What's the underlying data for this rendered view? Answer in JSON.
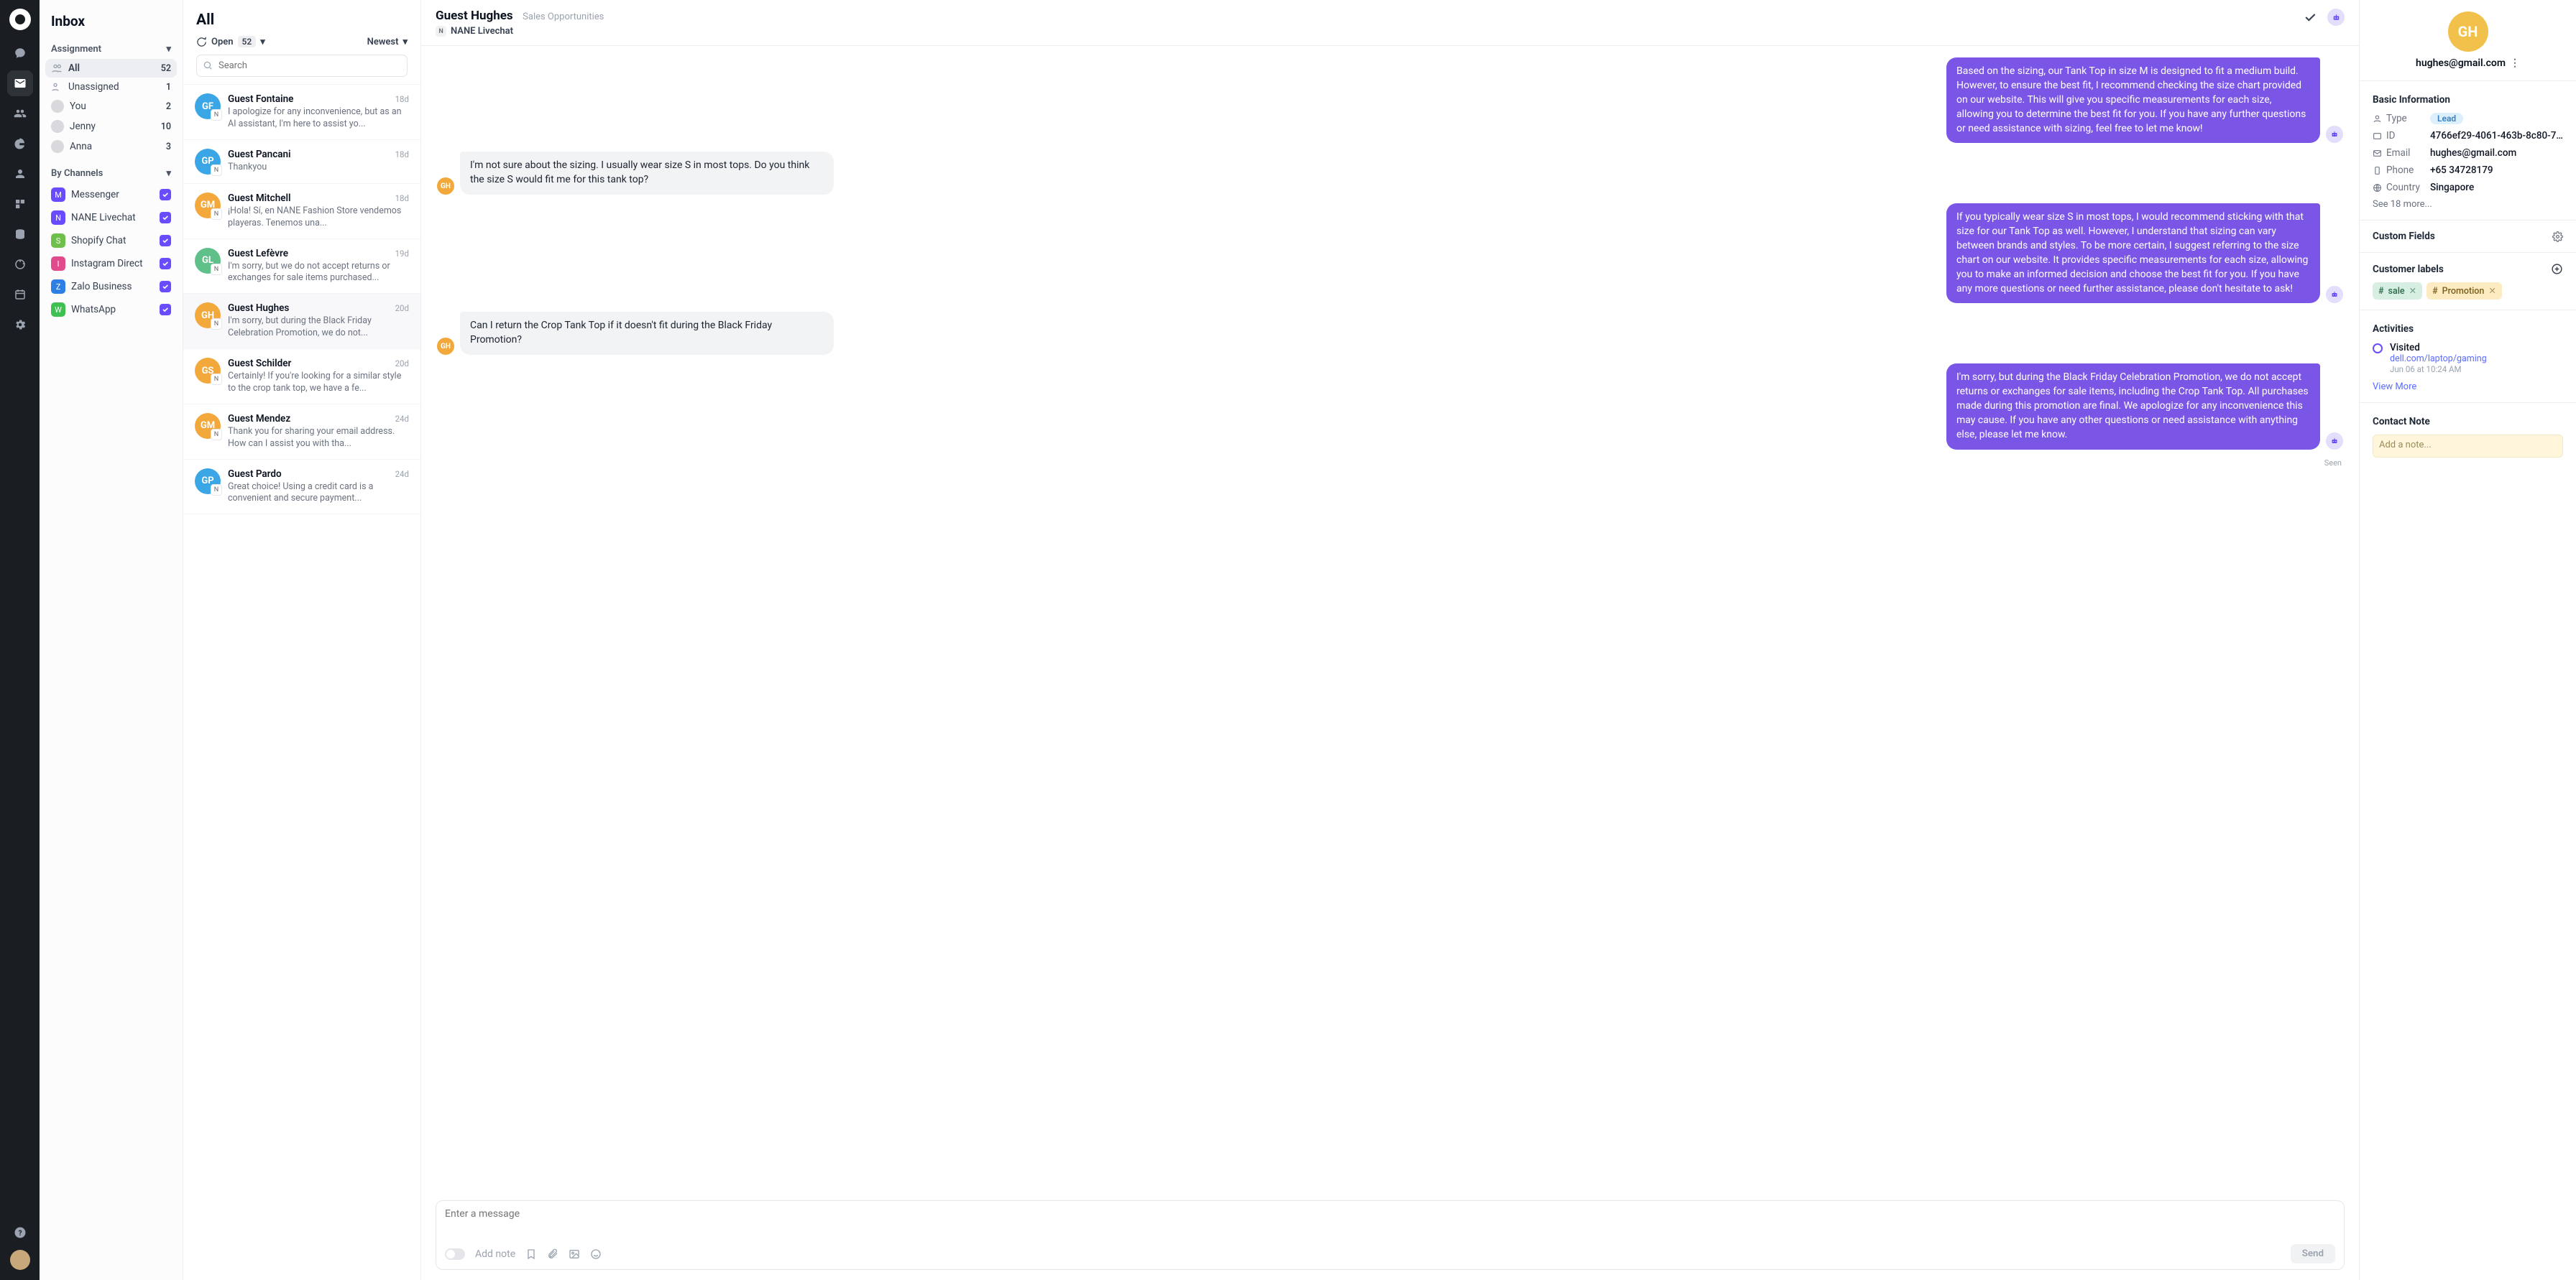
{
  "rail": {
    "items": [
      "chat",
      "inbox",
      "contacts",
      "reports",
      "profile",
      "apps",
      "data",
      "loop",
      "calendar",
      "settings"
    ]
  },
  "sidebar": {
    "title": "Inbox",
    "assignment_label": "Assignment",
    "items": [
      {
        "label": "All",
        "count": "52",
        "icon": "people"
      },
      {
        "label": "Unassigned",
        "count": "1",
        "icon": "person-outline"
      },
      {
        "label": "You",
        "count": "2",
        "icon": "avatar"
      },
      {
        "label": "Jenny",
        "count": "10",
        "icon": "avatar"
      },
      {
        "label": "Anna",
        "count": "3",
        "icon": "avatar"
      }
    ],
    "channels_label": "By Channels",
    "channels": [
      {
        "label": "Messenger",
        "color": "#6a4cff"
      },
      {
        "label": "NANE Livechat",
        "color": "#6a4cff"
      },
      {
        "label": "Shopify Chat",
        "color": "#6fbf4b"
      },
      {
        "label": "Instagram Direct",
        "color": "#e14b8c"
      },
      {
        "label": "Zalo Business",
        "color": "#2d7fe6"
      },
      {
        "label": "WhatsApp",
        "color": "#3fc051"
      }
    ]
  },
  "list": {
    "title": "All",
    "open_label": "Open",
    "open_count": "52",
    "sort_label": "Newest",
    "search_placeholder": "Search",
    "items": [
      {
        "initials": "GF",
        "color": "#3aa6e6",
        "name": "Guest Fontaine",
        "time": "18d",
        "preview": "I apologize for any inconvenience, but as an AI assistant, I'm here to assist yo..."
      },
      {
        "initials": "GP",
        "color": "#3aa6e6",
        "name": "Guest Pancani",
        "time": "18d",
        "preview": "Thankyou"
      },
      {
        "initials": "GM",
        "color": "#f2a83b",
        "name": "Guest Mitchell",
        "time": "18d",
        "preview": "¡Hola! Sí, en NANE Fashion Store vendemos playeras. Tenemos una..."
      },
      {
        "initials": "GL",
        "color": "#5fc08a",
        "name": "Guest Lefèvre",
        "time": "19d",
        "preview": "I'm sorry, but we do not accept returns or exchanges for sale items purchased..."
      },
      {
        "initials": "GH",
        "color": "#f2a83b",
        "name": "Guest Hughes",
        "time": "20d",
        "preview": "I'm sorry, but during the Black Friday Celebration Promotion, we do not..."
      },
      {
        "initials": "GS",
        "color": "#f2a83b",
        "name": "Guest Schilder",
        "time": "20d",
        "preview": "Certainly! If you're looking for a similar style to the crop tank top, we have a fe..."
      },
      {
        "initials": "GM",
        "color": "#f2a83b",
        "name": "Guest Mendez",
        "time": "24d",
        "preview": "Thank you for sharing your email address. How can I assist you with tha..."
      },
      {
        "initials": "GP",
        "color": "#3aa6e6",
        "name": "Guest Pardo",
        "time": "24d",
        "preview": "Great choice! Using a credit card is a convenient and secure payment..."
      }
    ]
  },
  "chat": {
    "title": "Guest Hughes",
    "meta": "Sales Opportunities",
    "channel": "NANE Livechat",
    "messages": [
      {
        "dir": "out",
        "text": "Based on the sizing, our Tank Top in size M is designed to fit a medium build. However, to ensure the best fit, I recommend checking the size chart provided on our website. This will give you specific measurements for each size, allowing you to determine the best fit for you. If you have any further questions or need assistance with sizing, feel free to let me know!"
      },
      {
        "dir": "in",
        "text": "I'm not sure about the sizing. I usually wear size S in most tops. Do you think the size S would fit me for this tank top?"
      },
      {
        "dir": "out",
        "text": "If you typically wear size S in most tops, I would recommend sticking with that size for our Tank Top as well. However, I understand that sizing can vary between brands and styles. To be more certain, I suggest referring to the size chart on our website. It provides specific measurements for each size, allowing you to make an informed decision and choose the best fit for you. If you have any more questions or need further assistance, please don't hesitate to ask!"
      },
      {
        "dir": "in",
        "text": "Can I return the Crop Tank Top if it doesn't fit during the Black Friday Promotion?"
      },
      {
        "dir": "out",
        "text": "I'm sorry, but during the Black Friday Celebration Promotion, we do not accept returns or exchanges for sale items, including the Crop Tank Top. All purchases made during this promotion are final. We apologize for any inconvenience this may cause. If you have any other questions or need assistance with anything else, please let me know."
      }
    ],
    "seen": "Seen",
    "composer_placeholder": "Enter a message",
    "addnote": "Add note",
    "send": "Send"
  },
  "details": {
    "initials": "GH",
    "email": "hughes@gmail.com",
    "basic_label": "Basic Information",
    "type_label": "Type",
    "type_value": "Lead",
    "id_label": "ID",
    "id_value": "4766ef29-4061-463b-8c80-7...",
    "email_label": "Email",
    "email_value": "hughes@gmail.com",
    "phone_label": "Phone",
    "phone_value": "+65 34728179",
    "country_label": "Country",
    "country_value": "Singapore",
    "see_more": "See 18 more...",
    "custom_fields": "Custom Fields",
    "labels_title": "Customer labels",
    "labels": [
      {
        "text": "sale",
        "cls": "sale"
      },
      {
        "text": "Promotion",
        "cls": "promo"
      }
    ],
    "activities_title": "Activities",
    "activity_action": "Visited",
    "activity_link": "dell.com/laptop/gaming",
    "activity_time": "Jun 06 at 10:24 AM",
    "view_more": "View More",
    "note_title": "Contact Note",
    "note_placeholder": "Add a note..."
  }
}
